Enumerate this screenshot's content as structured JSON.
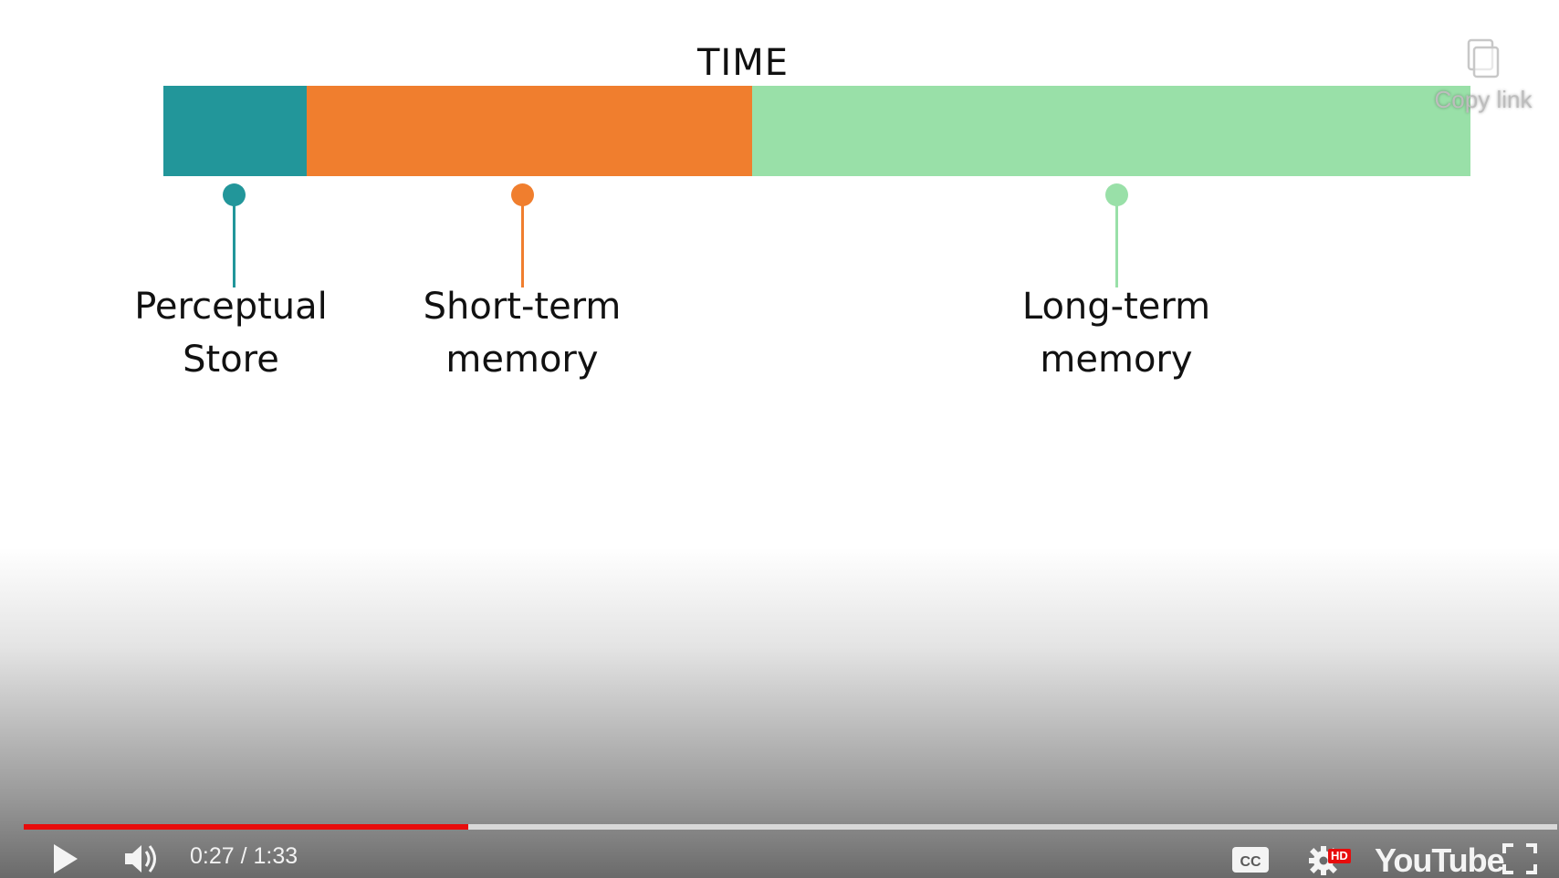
{
  "video": {
    "title_text": "TIME",
    "colors": {
      "perceptual": "#22969a",
      "short_term": "#f07e2e",
      "long_term": "#99e0a8"
    },
    "stages": [
      {
        "line1": "Perceptual",
        "line2": "Store"
      },
      {
        "line1": "Short-term",
        "line2": "memory"
      },
      {
        "line1": "Long-term",
        "line2": "memory"
      }
    ]
  },
  "overlay": {
    "copy_link_label": "Copy link",
    "copy_icon": "copy-icon"
  },
  "controls": {
    "play_icon": "play-icon",
    "volume_icon": "volume-icon",
    "current_time": "0:27",
    "duration": "1:33",
    "time_separator": " / ",
    "progress_fraction": 0.29,
    "progress_color": "#e80c0c",
    "cc_icon": "closed-captions-icon",
    "settings_icon": "gear-icon",
    "hd_badge": "HD",
    "logo_text": "YouTube",
    "fullscreen_icon": "fullscreen-icon"
  }
}
